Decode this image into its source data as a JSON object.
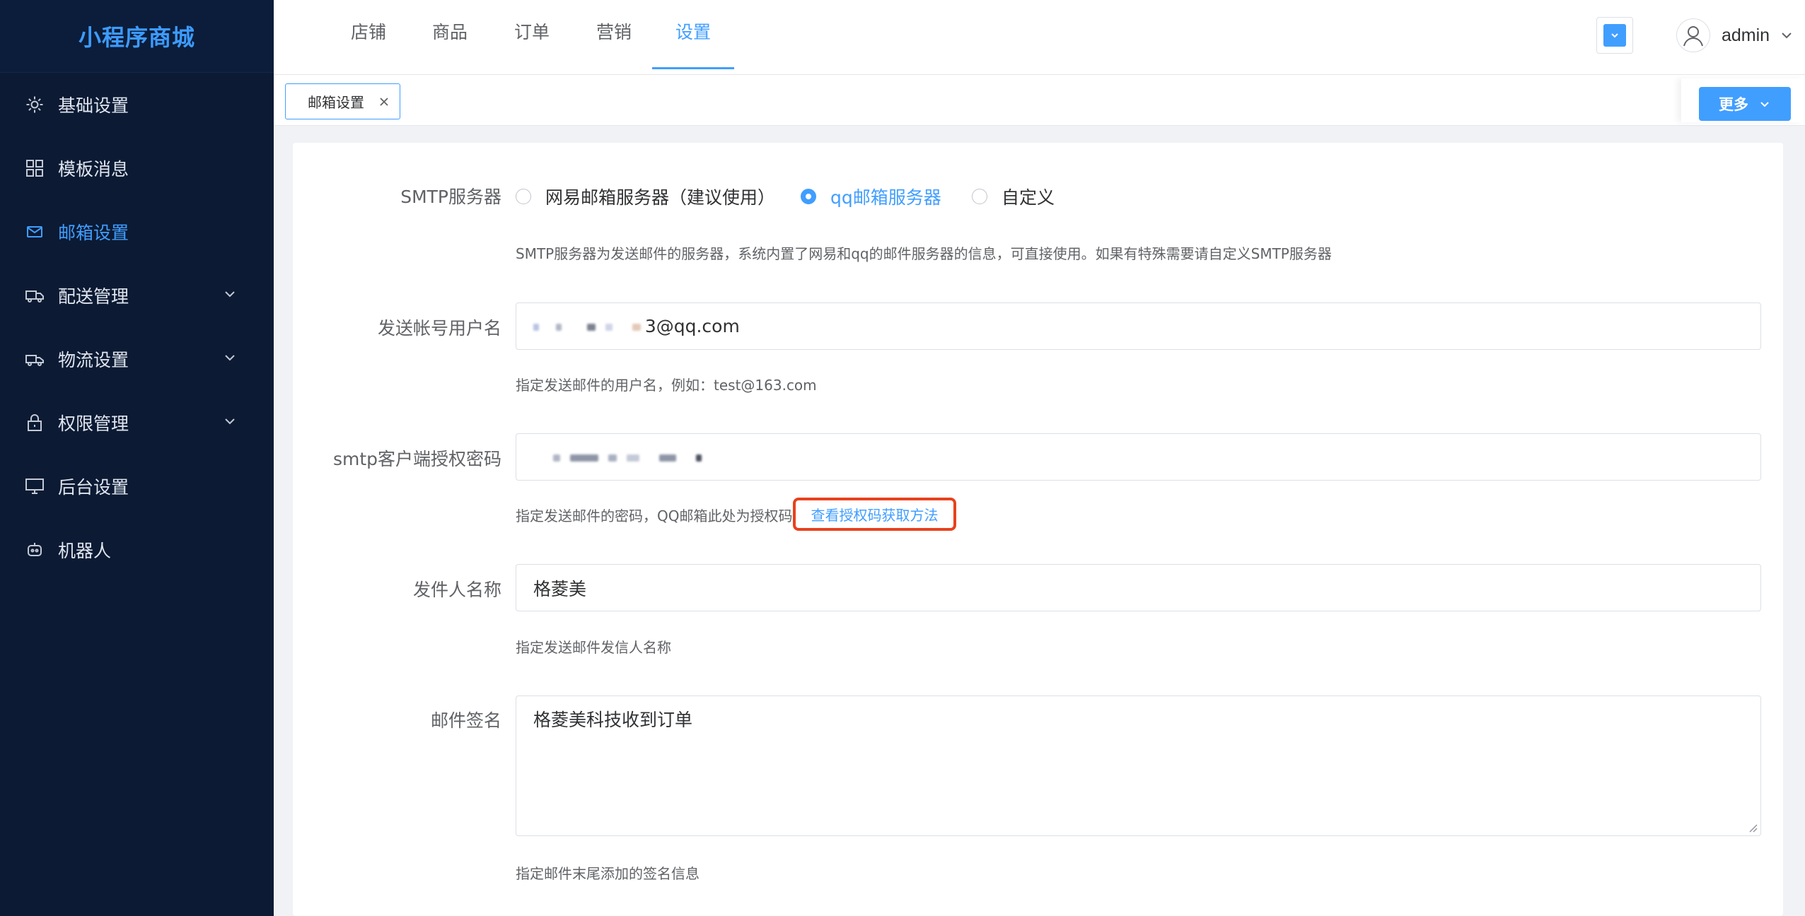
{
  "app": {
    "logo": "小程序商城"
  },
  "sidebar": {
    "items": [
      {
        "label": "基础设置",
        "icon": "gear-icon"
      },
      {
        "label": "模板消息",
        "icon": "grid-icon"
      },
      {
        "label": "邮箱设置",
        "icon": "mail-icon",
        "active": true
      },
      {
        "label": "配送管理",
        "icon": "delivery-icon",
        "expandable": true
      },
      {
        "label": "物流设置",
        "icon": "truck-icon",
        "expandable": true
      },
      {
        "label": "权限管理",
        "icon": "lock-icon",
        "expandable": true
      },
      {
        "label": "后台设置",
        "icon": "monitor-icon"
      },
      {
        "label": "机器人",
        "icon": "robot-icon"
      }
    ]
  },
  "header": {
    "tabs": [
      "店铺",
      "商品",
      "订单",
      "营销",
      "设置"
    ],
    "active_tab": "设置",
    "user": "admin"
  },
  "tabsbar": {
    "page_tab": "邮箱设置",
    "more_label": "更多"
  },
  "form": {
    "smtp": {
      "label": "SMTP服务器",
      "options": [
        "网易邮箱服务器（建议使用）",
        "qq邮箱服务器",
        "自定义"
      ],
      "selected": "qq邮箱服务器",
      "tip": "SMTP服务器为发送邮件的服务器，系统内置了网易和qq的邮件服务器的信息，可直接使用。如果有特殊需要请自定义SMTP服务器"
    },
    "username": {
      "label": "发送帐号用户名",
      "value_suffix": "3@qq.com",
      "tip": "指定发送邮件的用户名，例如：test@163.com"
    },
    "password": {
      "label": "smtp客户端授权密码",
      "tip": "指定发送邮件的密码，QQ邮箱此处为授权码",
      "link": "查看授权码获取方法"
    },
    "sender": {
      "label": "发件人名称",
      "value": "格菱美",
      "tip": "指定发送邮件发信人名称"
    },
    "signature": {
      "label": "邮件签名",
      "value": "格菱美科技收到订单",
      "tip": "指定邮件末尾添加的签名信息"
    }
  },
  "colors": {
    "accent": "#409eff",
    "sidebar_bg": "#0c1a33",
    "highlight": "#e8411d"
  }
}
